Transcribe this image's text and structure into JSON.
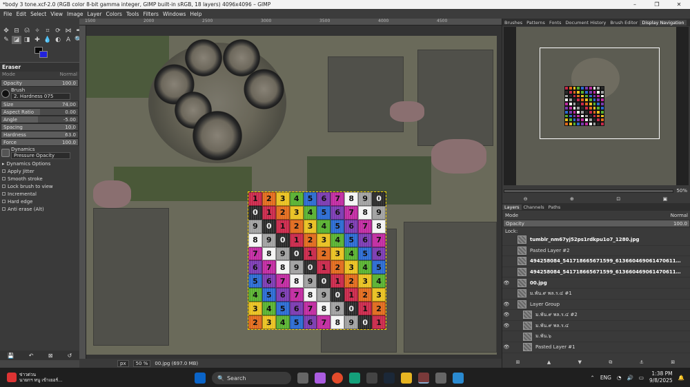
{
  "window": {
    "title": "*body 3 tone.xcf-2.0 (RGB color 8-bit gamma integer, GIMP built-in sRGB, 18 layers) 4096x4096 – GIMP",
    "controls": [
      "–",
      "❐",
      "✕"
    ]
  },
  "menu": [
    "File",
    "Edit",
    "Select",
    "View",
    "Image",
    "Layer",
    "Colors",
    "Tools",
    "Filters",
    "Windows",
    "Help"
  ],
  "tool_options": {
    "title": "Eraser",
    "mode_label": "Mode",
    "mode_value": "Normal",
    "opacity_label": "Opacity",
    "opacity_value": "100.0",
    "brush_label": "Brush",
    "brush_value": "2. Hardness 075",
    "sliders": [
      {
        "label": "Size",
        "value": "74.00",
        "fill": 0.9
      },
      {
        "label": "Aspect Ratio",
        "value": "0.00",
        "fill": 0.5
      },
      {
        "label": "Angle",
        "value": "-5.00",
        "fill": 0.48
      },
      {
        "label": "Spacing",
        "value": "10.0",
        "fill": 0.95
      },
      {
        "label": "Hardness",
        "value": "63.0",
        "fill": 0.85
      },
      {
        "label": "Force",
        "value": "100.0",
        "fill": 1.0
      }
    ],
    "dynamics_label": "Dynamics",
    "dynamics_value": "Pressure Opacity",
    "dynamics_options": "Dynamics Options",
    "checks": [
      "Apply Jitter",
      "Smooth stroke",
      "Lock brush to view",
      "Incremental",
      "Hard edge",
      "Anti erase  (Alt)"
    ]
  },
  "ruler": [
    "1500",
    "2000",
    "2500",
    "3000",
    "3500",
    "4000",
    "4500"
  ],
  "grid_rows": [
    [
      "1",
      "2",
      "3",
      "4",
      "5",
      "6",
      "7",
      "8",
      "9",
      "0"
    ],
    [
      "0",
      "1",
      "2",
      "3",
      "4",
      "5",
      "6",
      "7",
      "8",
      "9"
    ],
    [
      "9",
      "0",
      "1",
      "2",
      "3",
      "4",
      "5",
      "6",
      "7",
      "8"
    ],
    [
      "8",
      "9",
      "0",
      "1",
      "2",
      "3",
      "4",
      "5",
      "6",
      "7"
    ],
    [
      "7",
      "8",
      "9",
      "0",
      "1",
      "2",
      "3",
      "4",
      "5",
      "6"
    ],
    [
      "6",
      "7",
      "8",
      "9",
      "0",
      "1",
      "2",
      "3",
      "4",
      "5"
    ],
    [
      "5",
      "6",
      "7",
      "8",
      "9",
      "0",
      "1",
      "2",
      "3",
      "4"
    ],
    [
      "4",
      "5",
      "6",
      "7",
      "8",
      "9",
      "0",
      "1",
      "2",
      "3"
    ],
    [
      "3",
      "4",
      "5",
      "6",
      "7",
      "8",
      "9",
      "0",
      "1",
      "2"
    ],
    [
      "2",
      "3",
      "4",
      "5",
      "6",
      "7",
      "8",
      "9",
      "0",
      "1"
    ]
  ],
  "digit_colors": {
    "0": "#2a2a2a",
    "1": "#c8284a",
    "2": "#e06a1c",
    "3": "#e8c020",
    "4": "#58b030",
    "5": "#2a6ad0",
    "6": "#7a3ab0",
    "7": "#c02aa0",
    "8": "#f4f4f4",
    "9": "#a0a0a0"
  },
  "status": {
    "unit": "px",
    "zoom": "50 %",
    "info": "00.jpg (697.0 MB)"
  },
  "dock_tabs": [
    "Brushes",
    "Patterns",
    "Fonts",
    "Document History",
    "Brush Editor",
    "Display Navigation"
  ],
  "nav_zoom": "50%",
  "layers_tabs": [
    "Layers",
    "Channels",
    "Paths"
  ],
  "layers_mode": "Normal",
  "layers_opacity_label": "Opacity",
  "layers_opacity": "100.0",
  "lock_label": "Lock:",
  "layers": [
    {
      "name": "tumblr_nm67yj52ps1rdkpu1o7_1280.jpg",
      "eye": "",
      "bold": true
    },
    {
      "name": "Pasted Layer #2",
      "eye": "",
      "bold": false
    },
    {
      "name": "494258084_541718665671599_6136604690614706113_n.jpg",
      "eye": "",
      "bold": true
    },
    {
      "name": "494258084_541718665671599_6136604690614706113_n (1).jpg",
      "eye": "",
      "bold": true
    },
    {
      "name": "00.jpg",
      "eye": "👁",
      "bold": true
    },
    {
      "name": "ม.พัน.๙ พล.ร.๔ #1",
      "eye": "",
      "bold": false
    },
    {
      "name": "Layer Group",
      "eye": "👁",
      "bold": false
    },
    {
      "name": "ม.พัน.๙ พล.ร.๔ #2",
      "eye": "👁",
      "bold": false
    },
    {
      "name": "ม.พัน.๙ พล.ร.๔",
      "eye": "👁",
      "bold": false
    },
    {
      "name": "ม.พัน.๖",
      "eye": "",
      "bold": false
    },
    {
      "name": "Pasted Layer #1",
      "eye": "👁",
      "bold": false
    }
  ],
  "taskbar": {
    "news_line1": "ข่าวด่วน",
    "news_line2": "นายกฯ หนู เข้าเยอร์...",
    "search": "Search",
    "lang": "ENG",
    "time": "1:38 PM",
    "date": "9/8/2025"
  }
}
